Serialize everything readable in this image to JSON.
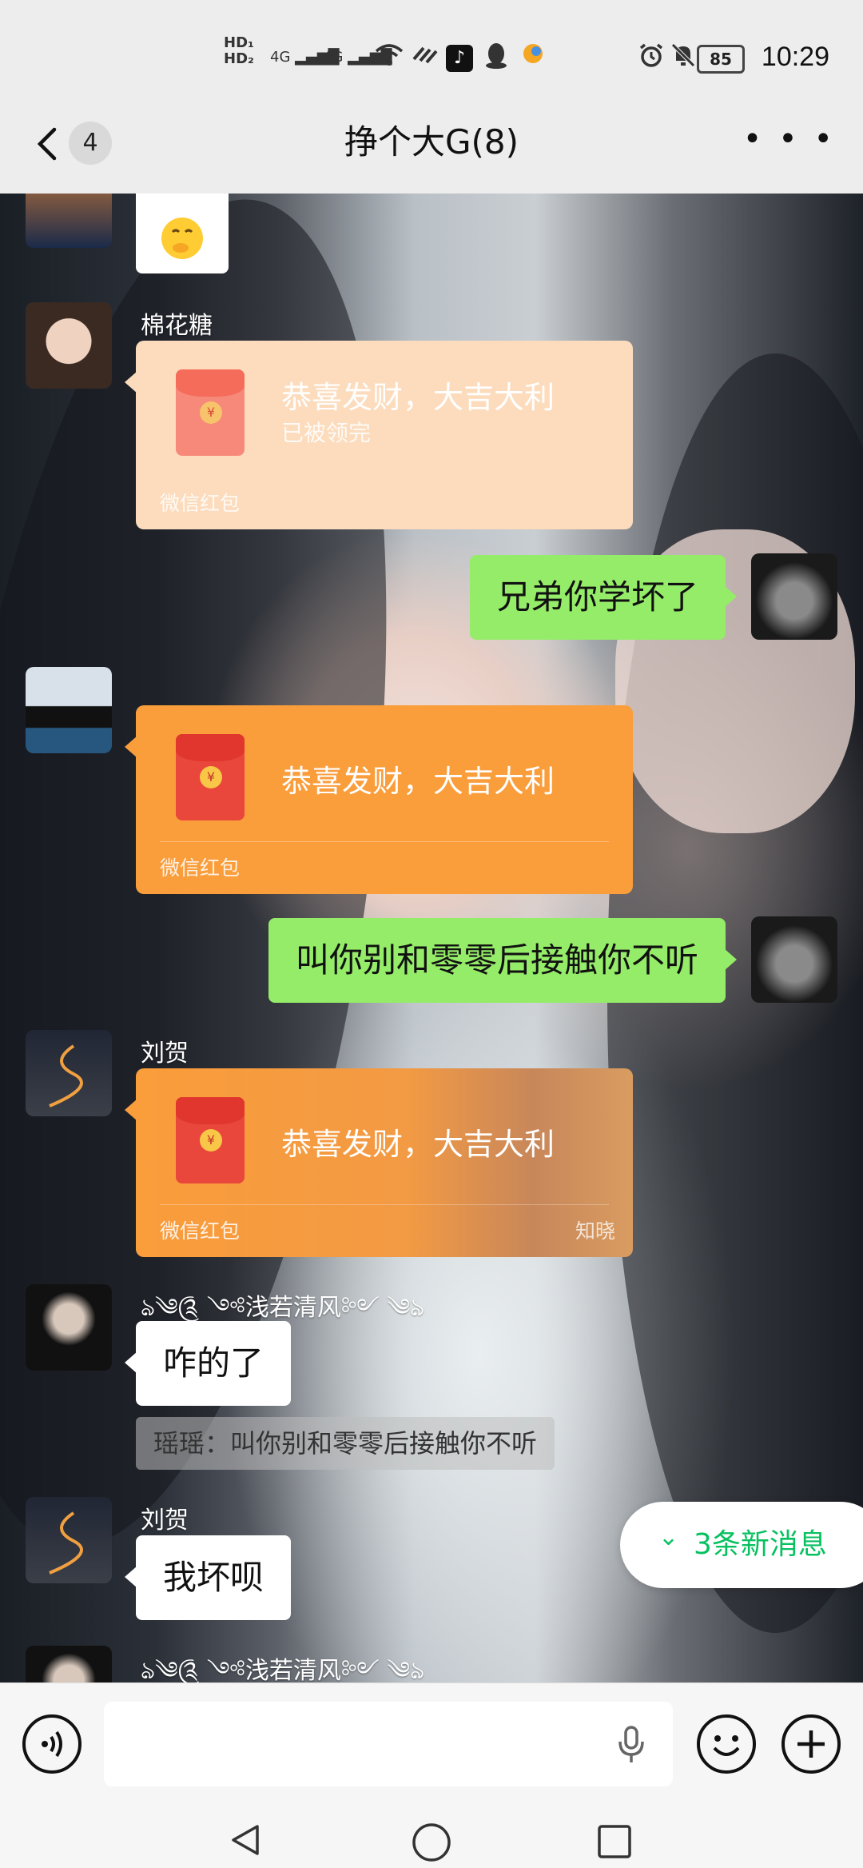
{
  "status_bar": {
    "signal1": "4G",
    "signal2": "4G",
    "hd1": "HD",
    "hd2": "HD",
    "battery": "85",
    "time": "10:29"
  },
  "header": {
    "back_count": "4",
    "title": "挣个大G(8)"
  },
  "messages": {
    "m1_sender": "棉花糖",
    "rp1_title": "恭喜发财，大吉大利",
    "rp1_status": "已被领完",
    "rp1_footer": "微信红包",
    "m2_text": "兄弟你学坏了",
    "rp2_title": "恭喜发财，大吉大利",
    "rp2_footer": "微信红包",
    "m3_text": "叫你别和零零后接触你不听",
    "m4_sender": "刘贺",
    "rp3_title": "恭喜发财，大吉大利",
    "rp3_footer": "微信红包",
    "rp3_brand": "知晓",
    "m5_sender": "ঌ༄༊ ༺浅若清风༻ ༄ঌ",
    "m5_text": "咋的了",
    "m5_quote": "瑶瑶：叫你别和零零后接触你不听",
    "m6_sender": "刘贺",
    "m6_text": "我坏呗",
    "m7_sender": "ঌ༄༊ ༺浅若清风༻ ༄ঌ"
  },
  "new_messages": {
    "label": "3条新消息"
  },
  "colors": {
    "green_bubble": "#95ec69",
    "redpacket_orange": "#fa9d3b",
    "redpacket_received": "#fcdcbd",
    "accent": "#07c160"
  },
  "icons": {
    "voice": "voice-icon",
    "emoji": "emoji-icon",
    "plus": "plus-icon",
    "mic": "mic-icon"
  }
}
